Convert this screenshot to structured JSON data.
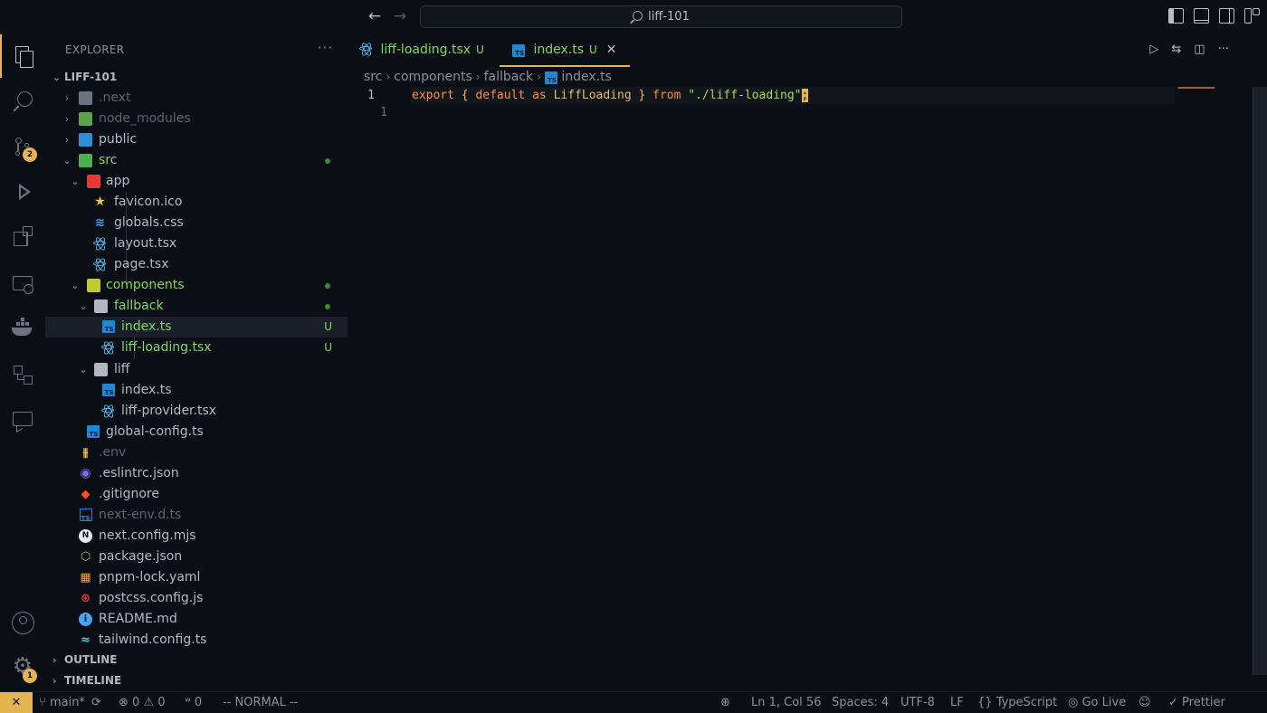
{
  "titlebar": {
    "search_text": "liff-101",
    "back": "←",
    "forward": "→"
  },
  "activity": {
    "scm_badge": "2",
    "settings_badge": "1"
  },
  "sidebar": {
    "header": "EXPLORER",
    "more": "···",
    "project": "LIFF-101",
    "items": [
      {
        "label": ".next",
        "status": ""
      },
      {
        "label": "node_modules",
        "status": ""
      },
      {
        "label": "public",
        "status": ""
      },
      {
        "label": "src",
        "status": ""
      },
      {
        "label": "app",
        "status": ""
      },
      {
        "label": "favicon.ico",
        "status": ""
      },
      {
        "label": "globals.css",
        "status": ""
      },
      {
        "label": "layout.tsx",
        "status": ""
      },
      {
        "label": "page.tsx",
        "status": ""
      },
      {
        "label": "components",
        "status": ""
      },
      {
        "label": "fallback",
        "status": ""
      },
      {
        "label": "index.ts",
        "status": "U"
      },
      {
        "label": "liff-loading.tsx",
        "status": "U"
      },
      {
        "label": "liff",
        "status": ""
      },
      {
        "label": "index.ts",
        "status": ""
      },
      {
        "label": "liff-provider.tsx",
        "status": ""
      },
      {
        "label": "global-config.ts",
        "status": ""
      },
      {
        "label": ".env",
        "status": ""
      },
      {
        "label": ".eslintrc.json",
        "status": ""
      },
      {
        "label": ".gitignore",
        "status": ""
      },
      {
        "label": "next-env.d.ts",
        "status": ""
      },
      {
        "label": "next.config.mjs",
        "status": ""
      },
      {
        "label": "package.json",
        "status": ""
      },
      {
        "label": "pnpm-lock.yaml",
        "status": ""
      },
      {
        "label": "postcss.config.js",
        "status": ""
      },
      {
        "label": "README.md",
        "status": ""
      },
      {
        "label": "tailwind.config.ts",
        "status": ""
      }
    ],
    "outline": "OUTLINE",
    "timeline": "TIMELINE"
  },
  "tabs": [
    {
      "label": "liff-loading.tsx",
      "mod": "U"
    },
    {
      "label": "index.ts",
      "mod": "U",
      "close": "✕"
    }
  ],
  "breadcrumb": [
    "src",
    "components",
    "fallback",
    "index.ts"
  ],
  "editor": {
    "line_numbers": [
      "1",
      "1"
    ],
    "code": {
      "kw1": "export",
      "ob": " { ",
      "kw2": "default",
      "kw3": " as ",
      "ident": "LiffLoading",
      "cb": " } ",
      "kw4": "from",
      "str": " \"./liff-loading\"",
      "semi": ";"
    }
  },
  "statusbar": {
    "remote": "✕",
    "branch": "main*",
    "errors": "0",
    "warnings": "0",
    "ports": "0",
    "mode": "-- NORMAL --",
    "position": "Ln 1, Col 56",
    "spaces": "Spaces: 4",
    "encoding": "UTF-8",
    "eol": "LF",
    "language": "TypeScript",
    "golive": "Go Live",
    "prettier": "Prettier"
  },
  "colors": {
    "accent": "#e6b450",
    "git_untracked": "#7fd962",
    "bg": "#0b0e14"
  }
}
